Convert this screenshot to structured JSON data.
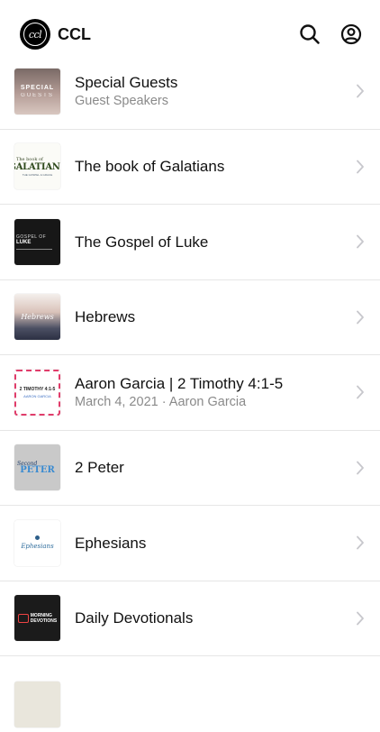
{
  "header": {
    "app_name": "CCL",
    "logo_text": "ccl",
    "icons": {
      "search": "search-icon",
      "account": "account-icon"
    }
  },
  "items": [
    {
      "title": "Special Guests",
      "subtitle": "Guest Speakers",
      "thumb": {
        "line1": "SPECIAL",
        "line2": "GUESTS"
      }
    },
    {
      "title": "The book of Galatians",
      "subtitle": "",
      "thumb": {
        "line1": "The book of",
        "line2": "GALATIANS",
        "line3": "THE GOSPEL & GRACE"
      }
    },
    {
      "title": "The Gospel of Luke",
      "subtitle": "",
      "thumb": {
        "line1": "GOSPEL OF",
        "line2": "LUKE"
      }
    },
    {
      "title": "Hebrews",
      "subtitle": "",
      "thumb": {
        "line1": "Hebrews"
      }
    },
    {
      "title": "Aaron Garcia | 2 Timothy 4:1-5",
      "subtitle": "March 4, 2021 · Aaron Garcia",
      "thumb": {
        "line1": "2 TIMOTHY 4:1-5",
        "line2": "AARON GARCIA"
      }
    },
    {
      "title": "2 Peter",
      "subtitle": "",
      "thumb": {
        "line1": "Second",
        "line2": "PETER"
      }
    },
    {
      "title": "Ephesians",
      "subtitle": "",
      "thumb": {
        "line1": "Ephesians"
      }
    },
    {
      "title": "Daily Devotionals",
      "subtitle": "",
      "thumb": {
        "line1": "MORNING",
        "line2": "DEVOTIONS"
      }
    }
  ],
  "colors": {
    "divider": "#e6e6e6",
    "subtitle": "#8a8a8a",
    "chevron": "#c7c7cc"
  }
}
